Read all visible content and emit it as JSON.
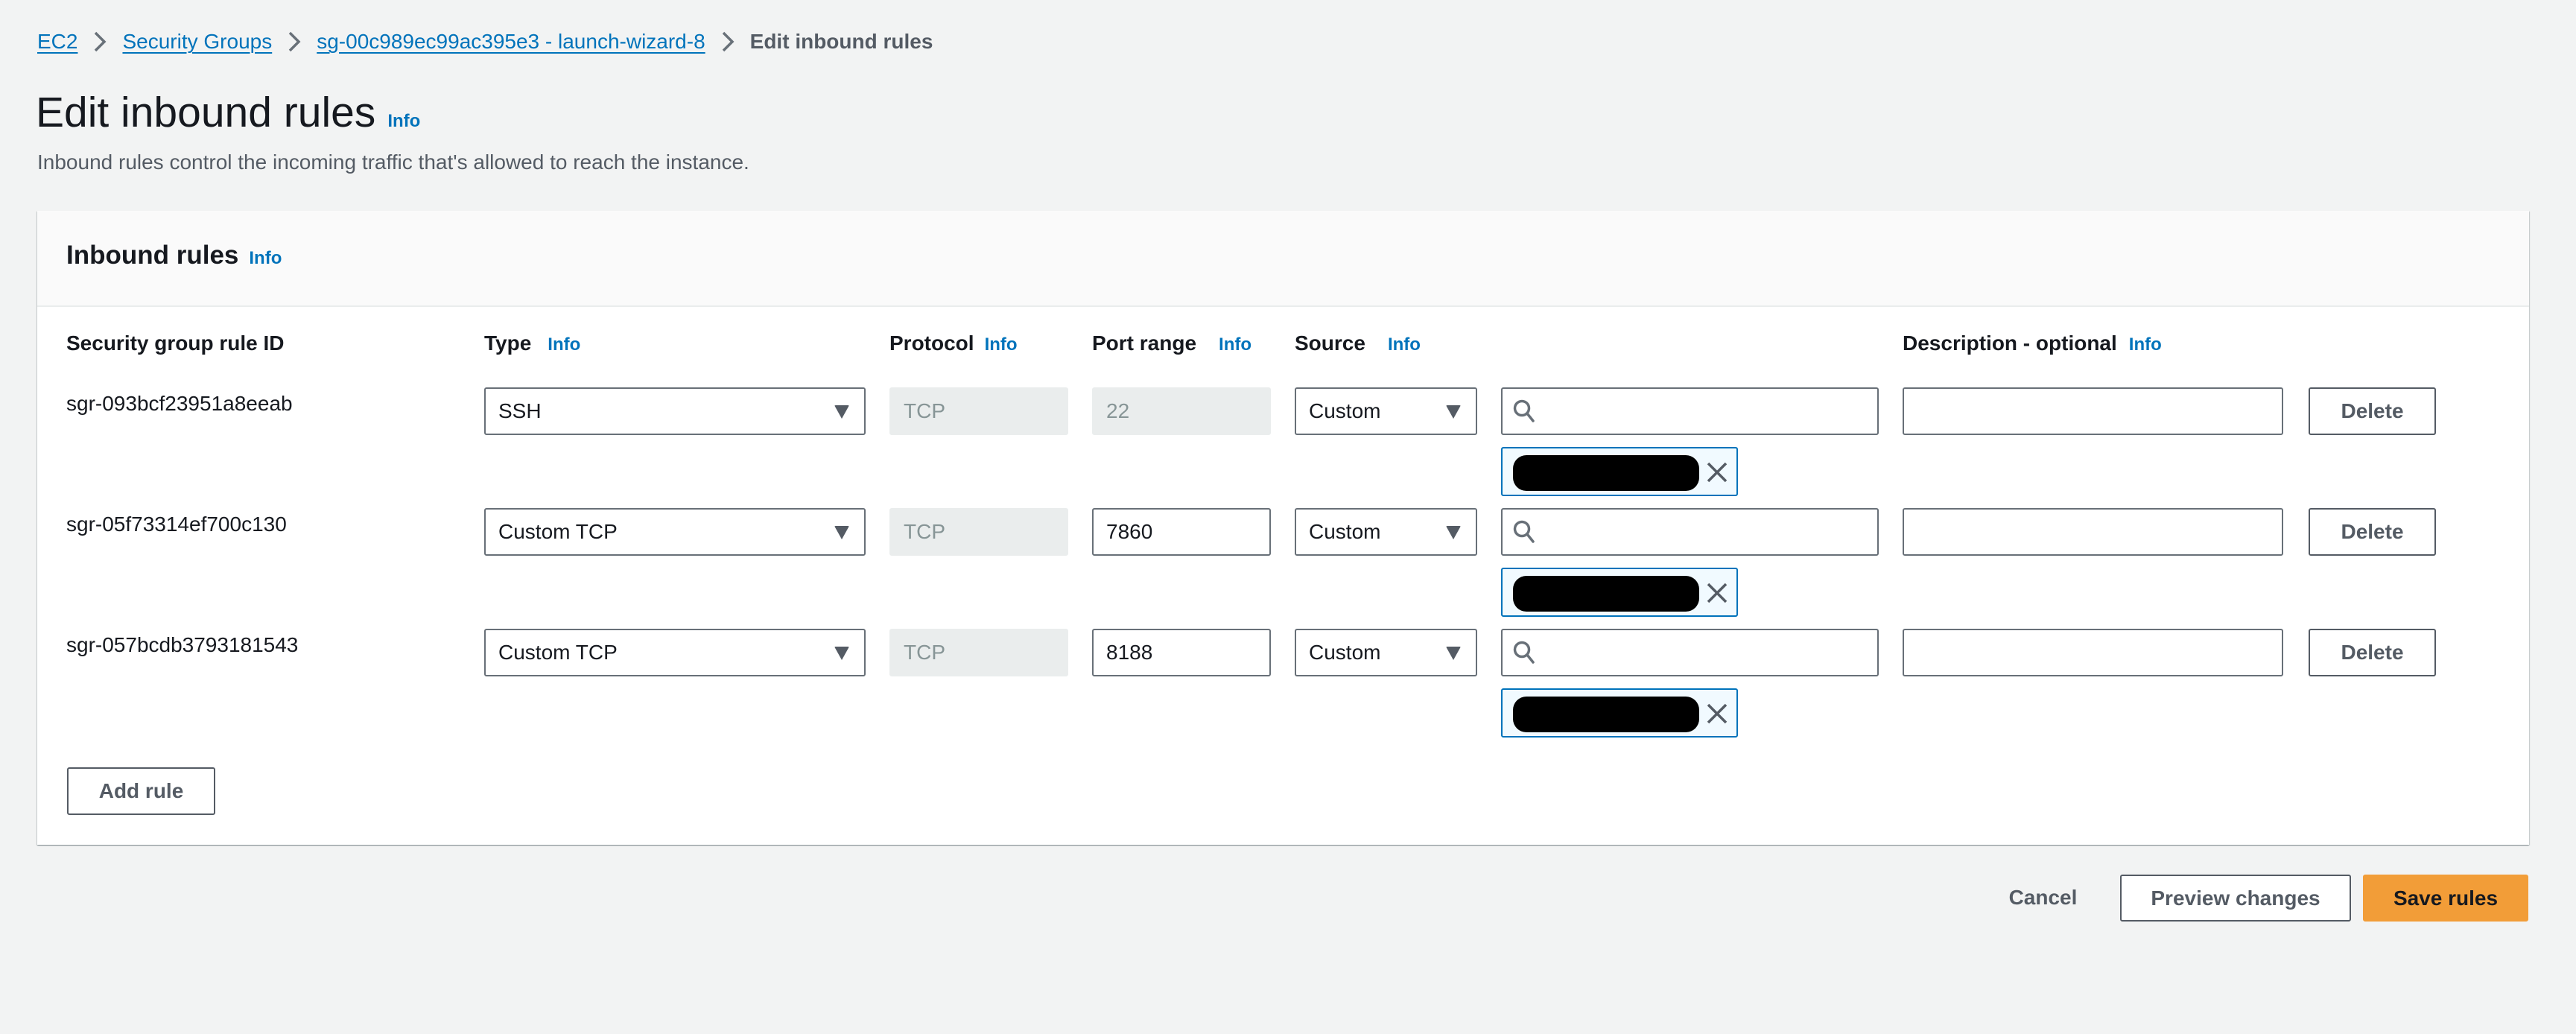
{
  "breadcrumb": {
    "items": [
      {
        "label": "EC2",
        "link": true
      },
      {
        "label": "Security Groups",
        "link": true
      },
      {
        "label": "sg-00c989ec99ac395e3 - launch-wizard-8",
        "link": true
      },
      {
        "label": "Edit inbound rules",
        "link": false
      }
    ]
  },
  "page": {
    "title": "Edit inbound rules",
    "info_label": "Info",
    "description": "Inbound rules control the incoming traffic that's allowed to reach the instance."
  },
  "panel": {
    "title": "Inbound rules",
    "info_label": "Info",
    "columns": {
      "rule_id": "Security group rule ID",
      "type": "Type",
      "protocol": "Protocol",
      "port_range": "Port range",
      "source": "Source",
      "description": "Description - optional"
    },
    "column_info_label": "Info",
    "rules": [
      {
        "rule_id": "sgr-093bcf23951a8eeab",
        "type": "SSH",
        "protocol": "TCP",
        "port_range": "22",
        "port_range_disabled": true,
        "source": "Custom",
        "search_value": "",
        "token": "[redacted]",
        "description": "",
        "delete_label": "Delete"
      },
      {
        "rule_id": "sgr-05f73314ef700c130",
        "type": "Custom TCP",
        "protocol": "TCP",
        "port_range": "7860",
        "port_range_disabled": false,
        "source": "Custom",
        "search_value": "",
        "token": "[redacted]",
        "description": "",
        "delete_label": "Delete"
      },
      {
        "rule_id": "sgr-057bcdb3793181543",
        "type": "Custom TCP",
        "protocol": "TCP",
        "port_range": "8188",
        "port_range_disabled": false,
        "source": "Custom",
        "search_value": "",
        "token": "[redacted]",
        "description": "",
        "delete_label": "Delete"
      }
    ],
    "add_rule_label": "Add rule"
  },
  "footer": {
    "cancel_label": "Cancel",
    "preview_label": "Preview changes",
    "save_label": "Save rules"
  },
  "colors": {
    "link": "#0073bb",
    "primary_button": "#f29d38",
    "background": "#f2f3f3",
    "token_border": "#0073bb"
  }
}
